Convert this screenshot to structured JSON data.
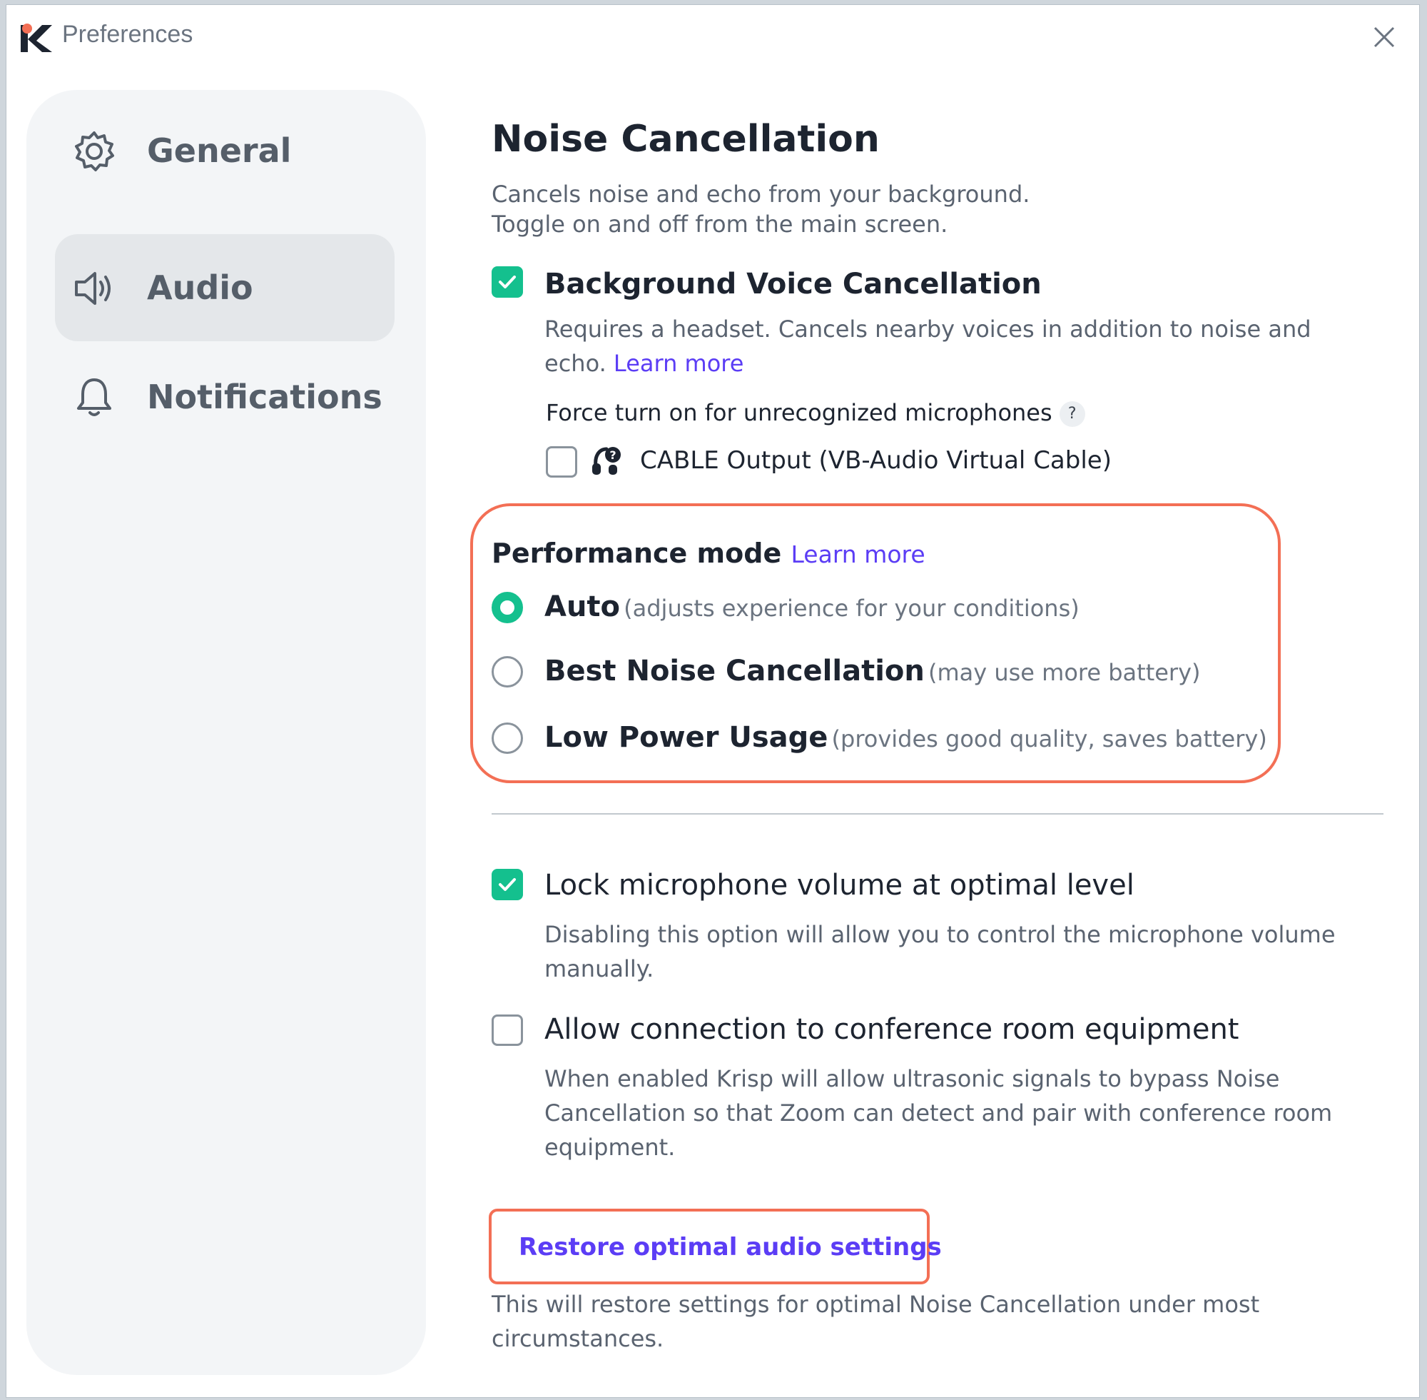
{
  "window": {
    "title": "Preferences"
  },
  "sidebar": {
    "items": [
      {
        "label": "General",
        "icon": "gear-icon",
        "active": false
      },
      {
        "label": "Audio",
        "icon": "speaker-icon",
        "active": true
      },
      {
        "label": "Notifications",
        "icon": "bell-icon",
        "active": false
      }
    ]
  },
  "main": {
    "heading": "Noise Cancellation",
    "description_line1": "Cancels noise and echo from your background.",
    "description_line2": "Toggle on and off from the main screen.",
    "bvc": {
      "label": "Background Voice Cancellation",
      "checked": true,
      "desc_line1": "Requires a headset. Cancels nearby voices in addition to noise and",
      "desc_line2": "echo.",
      "learn_more": "Learn more"
    },
    "force": {
      "label": "Force turn on for unrecognized microphones",
      "help": "?",
      "device_label": "CABLE Output (VB-Audio Virtual Cable)",
      "device_icon": "headset-question-icon",
      "checked": false
    },
    "performance": {
      "title": "Performance mode",
      "learn_more": "Learn more",
      "options": [
        {
          "label": "Auto",
          "note": "(adjusts experience for your conditions)",
          "selected": true
        },
        {
          "label": "Best Noise Cancellation",
          "note": "(may use more battery)",
          "selected": false
        },
        {
          "label": "Low Power Usage",
          "note": "(provides good quality, saves battery)",
          "selected": false
        }
      ]
    },
    "lock_volume": {
      "label": "Lock microphone volume at optimal level",
      "checked": true,
      "desc_line1": "Disabling this option will allow you to control the microphone volume",
      "desc_line2": "manually."
    },
    "conference": {
      "label": "Allow connection to conference room equipment",
      "checked": false,
      "desc_line1": "When enabled Krisp will allow ultrasonic signals to bypass Noise",
      "desc_line2": "Cancellation so that Zoom can detect and pair with conference room",
      "desc_line3": "equipment."
    },
    "restore": {
      "button_label": "Restore optimal audio settings",
      "desc_line1": "This will restore settings for optimal Noise Cancellation under most",
      "desc_line2": "circumstances."
    }
  },
  "colors": {
    "accent_green": "#14c08e",
    "link_purple": "#5b3df5",
    "highlight_orange": "#f36f55",
    "logo_orange": "#f36f55"
  }
}
